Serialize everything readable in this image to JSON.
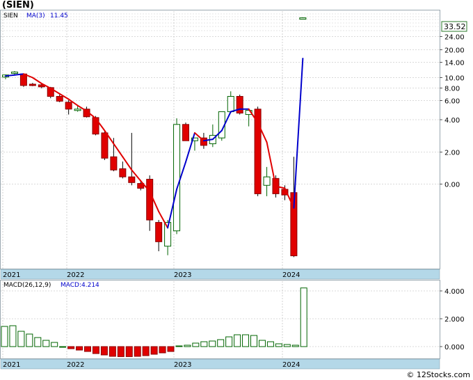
{
  "header": {
    "symbol_title": "(SIEN)"
  },
  "footer": {
    "copyright": "© 12Stocks.com"
  },
  "chart_data": [
    {
      "type": "candlestick",
      "scale": "log",
      "legend": {
        "symbol": "SIEN",
        "ma_label": "MA(3)",
        "ma_value": "11.45"
      },
      "price_badge": "33.52",
      "y_tick_labels": [
        "24.00",
        "20.00",
        "14.00",
        "10.00",
        "8.00",
        "6.00",
        "4.00",
        "2.00",
        "0.00"
      ],
      "x_tick_labels": [
        "2021",
        "2022",
        "2023",
        "2024"
      ],
      "colors": {
        "up_fill": "#ffffff",
        "up_stroke": "#006400",
        "down_fill": "#e00000",
        "ma_up": "#0000cc",
        "ma_down": "#e00000",
        "axis_band": "#b4d8e8"
      },
      "candles": [
        {
          "open": 7.0,
          "high": 7.5,
          "low": 6.6,
          "close": 7.4
        },
        {
          "open": 7.8,
          "high": 8.2,
          "low": 7.3,
          "close": 8.0
        },
        {
          "open": 7.6,
          "high": 7.7,
          "low": 5.4,
          "close": 5.6
        },
        {
          "open": 5.8,
          "high": 6.0,
          "low": 5.5,
          "close": 5.6
        },
        {
          "open": 5.7,
          "high": 5.9,
          "low": 5.2,
          "close": 5.4
        },
        {
          "open": 5.3,
          "high": 5.4,
          "low": 4.0,
          "close": 4.2
        },
        {
          "open": 4.2,
          "high": 4.4,
          "low": 3.6,
          "close": 3.7
        },
        {
          "open": 3.6,
          "high": 3.8,
          "low": 2.6,
          "close": 3.0
        },
        {
          "open": 3.0,
          "high": 3.3,
          "low": 2.8,
          "close": 3.0
        },
        {
          "open": 3.0,
          "high": 3.2,
          "low": 2.4,
          "close": 2.45
        },
        {
          "open": 2.4,
          "high": 2.5,
          "low": 1.5,
          "close": 1.55
        },
        {
          "open": 1.6,
          "high": 1.7,
          "low": 0.78,
          "close": 0.82
        },
        {
          "open": 0.85,
          "high": 1.4,
          "low": 0.58,
          "close": 0.6
        },
        {
          "open": 0.62,
          "high": 0.75,
          "low": 0.48,
          "close": 0.5
        },
        {
          "open": 0.5,
          "high": 1.6,
          "low": 0.4,
          "close": 0.43
        },
        {
          "open": 0.42,
          "high": 0.46,
          "low": 0.35,
          "close": 0.37
        },
        {
          "open": 0.47,
          "high": 0.52,
          "low": 0.12,
          "close": 0.16
        },
        {
          "open": 0.15,
          "high": 0.16,
          "low": 0.07,
          "close": 0.09
        },
        {
          "open": 0.08,
          "high": 0.16,
          "low": 0.063,
          "close": 0.15
        },
        {
          "open": 0.12,
          "high": 2.35,
          "low": 0.11,
          "close": 2.0
        },
        {
          "open": 2.0,
          "high": 2.1,
          "low": 1.3,
          "close": 1.3
        },
        {
          "open": 1.3,
          "high": 1.4,
          "low": 1.0,
          "close": 1.4
        },
        {
          "open": 1.4,
          "high": 1.6,
          "low": 1.05,
          "close": 1.15
        },
        {
          "open": 1.2,
          "high": 2.0,
          "low": 1.1,
          "close": 1.5
        },
        {
          "open": 1.4,
          "high": 2.8,
          "low": 1.3,
          "close": 2.8
        },
        {
          "open": 2.8,
          "high": 4.8,
          "low": 2.7,
          "close": 4.2
        },
        {
          "open": 4.2,
          "high": 4.4,
          "low": 2.6,
          "close": 2.7
        },
        {
          "open": 2.6,
          "high": 2.9,
          "low": 1.9,
          "close": 2.9
        },
        {
          "open": 3.0,
          "high": 3.2,
          "low": 0.3,
          "close": 0.32
        },
        {
          "open": 0.4,
          "high": 0.65,
          "low": 0.3,
          "close": 0.5
        },
        {
          "open": 0.48,
          "high": 0.52,
          "low": 0.29,
          "close": 0.32
        },
        {
          "open": 0.36,
          "high": 0.4,
          "low": 0.27,
          "close": 0.31
        },
        {
          "open": 0.33,
          "high": 0.85,
          "low": 0.06,
          "close": 0.062
        },
        {
          "open": 33.0,
          "high": 34.0,
          "low": 32.5,
          "close": 33.52
        }
      ],
      "ma3": [
        7.2,
        7.4,
        7.6,
        6.9,
        5.9,
        5.2,
        4.5,
        3.9,
        3.3,
        2.85,
        2.35,
        1.7,
        1.2,
        0.85,
        0.6,
        0.45,
        0.34,
        0.2,
        0.13,
        0.36,
        0.74,
        1.6,
        1.3,
        1.35,
        1.7,
        2.8,
        3.0,
        3.0,
        2.1,
        1.25,
        0.39,
        0.37,
        0.22,
        11.45
      ]
    },
    {
      "type": "bar",
      "legend": {
        "label": "MACD(26,12,9)",
        "macd_label": "MACD:4.214"
      },
      "y_tick_labels": [
        "4.000",
        "2.000",
        "0.000"
      ],
      "x_tick_labels": [
        "2021",
        "2022",
        "2023",
        "2024"
      ],
      "ylim": [
        -0.8,
        4.7
      ],
      "values": [
        1.45,
        1.5,
        1.1,
        0.9,
        0.65,
        0.45,
        0.3,
        0.0,
        -0.15,
        -0.25,
        -0.35,
        -0.5,
        -0.6,
        -0.7,
        -0.72,
        -0.72,
        -0.7,
        -0.65,
        -0.55,
        -0.45,
        -0.35,
        0.05,
        0.1,
        0.25,
        0.35,
        0.4,
        0.5,
        0.7,
        0.85,
        0.85,
        0.8,
        0.45,
        0.35,
        0.2,
        0.15,
        0.1,
        4.214
      ]
    }
  ]
}
